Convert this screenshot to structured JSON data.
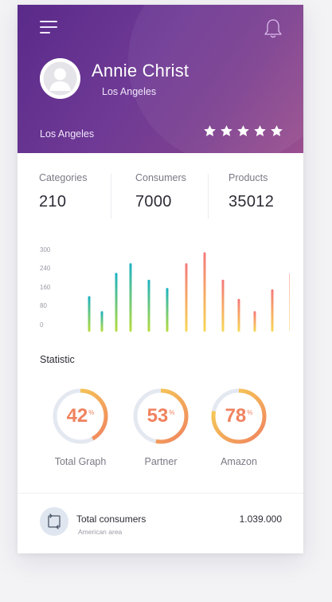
{
  "profile": {
    "name": "Annie Christ",
    "location": "Los Angeles",
    "location_secondary": "Los Angeles",
    "rating": 5,
    "rating_max": 5
  },
  "stats": [
    {
      "label": "Categories",
      "value": "210"
    },
    {
      "label": "Consumers",
      "value": "7000"
    },
    {
      "label": "Products",
      "value": "35012"
    }
  ],
  "chart_data": {
    "type": "bar",
    "y_ticks": [
      "300",
      "240",
      "160",
      "80",
      "0"
    ],
    "ylim": [
      0,
      300
    ],
    "grid": false,
    "series": [
      {
        "values": [
          130,
          75,
          215,
          250,
          190,
          160
        ],
        "colors": [
          "#1bb1c4",
          "#b8dd3c"
        ]
      },
      {
        "values": [
          250,
          290,
          190,
          120,
          75,
          155,
          215
        ],
        "colors": [
          "#f4787a",
          "#f7d855"
        ]
      }
    ]
  },
  "statistic": {
    "title": "Statistic",
    "items": [
      {
        "value": "42",
        "unit": "%",
        "label": "Total Graph"
      },
      {
        "value": "53",
        "unit": "%",
        "label": "Partner"
      },
      {
        "value": "78",
        "unit": "%",
        "label": "Amazon"
      }
    ]
  },
  "footer": {
    "icon": "repeat-icon",
    "title": "Total consumers",
    "subtitle": "American area",
    "value": "1.039.000"
  },
  "colors": {
    "header_start": "#5a2a8a",
    "header_end": "#9a4f8f",
    "accent_orange": "#f0825f",
    "accent_yellow": "#f7d855",
    "accent_cyan": "#1bb1c4",
    "accent_green": "#b8dd3c"
  },
  "icons": [
    "menu-icon",
    "bell-icon",
    "avatar",
    "star-icon",
    "repeat-icon"
  ]
}
